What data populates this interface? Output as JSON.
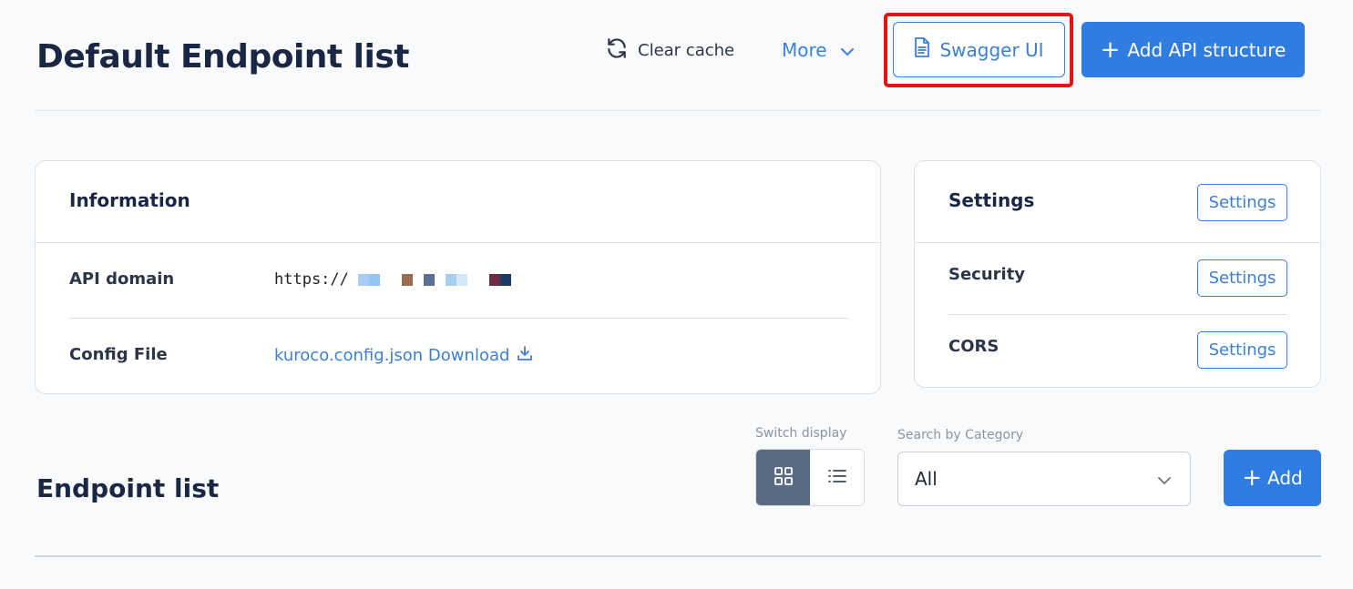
{
  "header": {
    "title": "Default Endpoint list",
    "clear_cache_label": "Clear cache",
    "more_label": "More",
    "swagger_label": "Swagger UI",
    "add_api_label": "Add API structure"
  },
  "information": {
    "heading": "Information",
    "api_domain_label": "API domain",
    "api_domain_value": "https://",
    "api_domain_masked_colors": [
      "#a9cdf0",
      "#91c6f2",
      "#ffffff",
      "#ffffff",
      "#9c6a4e",
      "#ffffff",
      "#5a6f93",
      "#ffffff",
      "#a7cdef",
      "#d3e9f8",
      "#ffffff",
      "#ffffff",
      "#6e2a46",
      "#1c3d63"
    ],
    "config_file_label": "Config File",
    "config_file_link": "kuroco.config.json Download"
  },
  "settings": {
    "heading": "Settings",
    "heading_button": "Settings",
    "rows": [
      {
        "label": "Security",
        "button": "Settings"
      },
      {
        "label": "CORS",
        "button": "Settings"
      }
    ]
  },
  "endpoint_list": {
    "title": "Endpoint list",
    "switch_display_label": "Switch display",
    "category_label": "Search by Category",
    "category_value": "All",
    "add_label": "Add"
  },
  "colors": {
    "accent": "#2f7de1",
    "highlight": "#e01515",
    "active_toggle": "#5a6a80"
  }
}
